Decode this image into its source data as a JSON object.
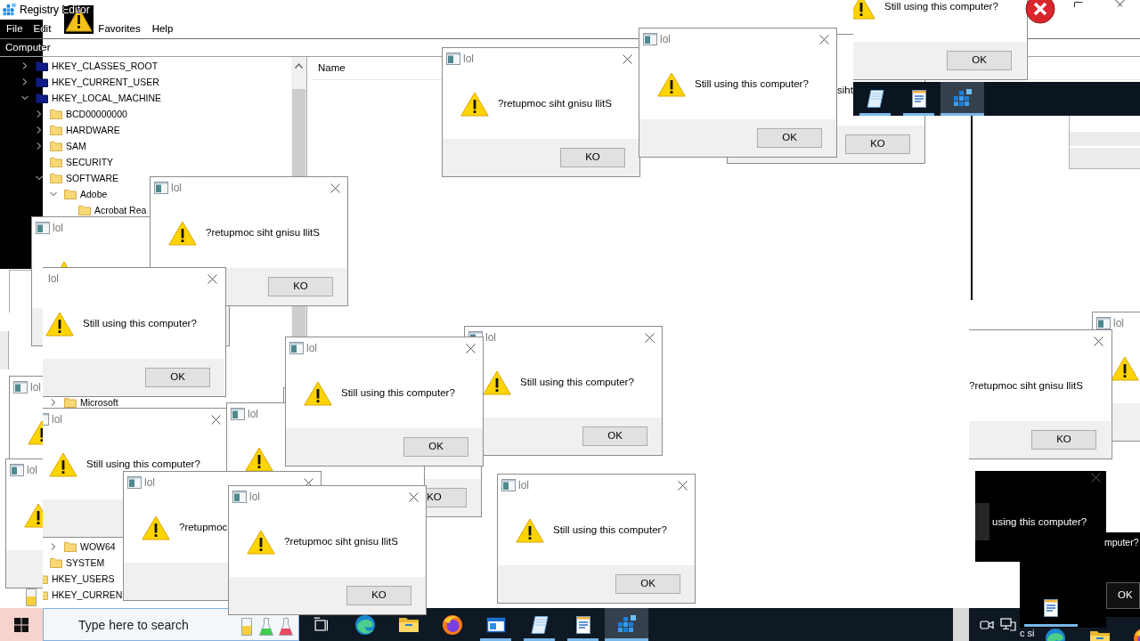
{
  "registry_editor": {
    "title": "Registry Editor",
    "menu": [
      {
        "label": "File"
      },
      {
        "label": "Edit"
      },
      {
        "label": "Favorites"
      },
      {
        "label": "Help"
      }
    ],
    "address": "Computer",
    "tree": [
      {
        "label": "HKEY_CLASSES_ROOT",
        "expanded": false
      },
      {
        "label": "HKEY_CURRENT_USER",
        "expanded": false
      },
      {
        "label": "HKEY_LOCAL_MACHINE",
        "expanded": true,
        "children": [
          {
            "label": "BCD00000000",
            "expanded": false
          },
          {
            "label": "HARDWARE",
            "expanded": false
          },
          {
            "label": "SAM",
            "expanded": false
          },
          {
            "label": "SECURITY"
          },
          {
            "label": "SOFTWARE",
            "expanded": true,
            "children": [
              {
                "label": "Adobe",
                "expanded": true,
                "children": [
                  {
                    "label": "Acrobat Rea"
                  }
                ]
              },
              {
                "label": "Microsoft",
                "expanded": false
              },
              {
                "label": "WOW64",
                "expanded": false
              }
            ]
          },
          {
            "label": "SYSTEM"
          }
        ]
      },
      {
        "label": "HKEY_USERS"
      },
      {
        "label": "HKEY_CURREN"
      }
    ],
    "list_header": "Name"
  },
  "dialogs": [
    {
      "title": "lol",
      "message": "?retupmoc siht gnisu llitS",
      "button": "KO"
    },
    {
      "title": "lol",
      "message": "Still using this computer?",
      "button": "OK"
    },
    {
      "message": "siht",
      "button": "KO"
    },
    {
      "message": "Still using this computer?",
      "button": "OK"
    },
    {
      "title": "lol"
    },
    {
      "title": "lol",
      "message": "Still using this computer?",
      "button": "OK"
    },
    {
      "title": "lol",
      "message": "?retupmoc siht gnisu llitS",
      "button": "KO"
    },
    {
      "title": "lol"
    },
    {
      "title": "lol",
      "message": "Still using this computer?"
    },
    {
      "title": "lol"
    },
    {
      "button": "KO"
    },
    {
      "title": "lol",
      "message": "Still using this computer?",
      "button": "OK"
    },
    {
      "title": "lol",
      "message": "Still using this computer?",
      "button": "OK"
    },
    {
      "message": "?retupmoc siht gnisu llitS",
      "button": "KO"
    },
    {
      "title": "lol"
    },
    {
      "title": "lol"
    },
    {
      "title": "lol",
      "message": "?retupmoc"
    },
    {
      "title": "lol",
      "message": "?retupmoc siht gnisu llitS",
      "button": "KO"
    },
    {
      "title": "lol",
      "message": "Still using this computer?",
      "button": "OK"
    }
  ],
  "taskbar": {
    "search": {
      "placeholder": "Type here to search"
    },
    "apps": [
      {
        "open": false,
        "selected": false
      },
      {
        "open": false,
        "selected": false
      },
      {
        "open": false,
        "selected": false
      },
      {
        "open": false,
        "selected": false
      },
      {
        "open": true,
        "selected": false
      },
      {
        "open": true,
        "selected": false
      },
      {
        "open": true,
        "selected": false
      },
      {
        "open": true,
        "selected": true
      }
    ],
    "partial_label": "c si"
  },
  "taskbar_fragment": {
    "apps": [
      {
        "open": true,
        "selected": false
      },
      {
        "open": true,
        "selected": false
      },
      {
        "open": true,
        "selected": true
      }
    ]
  },
  "dark_fragments": {
    "window": {
      "message": "using this computer?"
    },
    "window_2": {
      "message": "mputer?",
      "button": "OK"
    },
    "task_button": {
      "open": true
    }
  }
}
